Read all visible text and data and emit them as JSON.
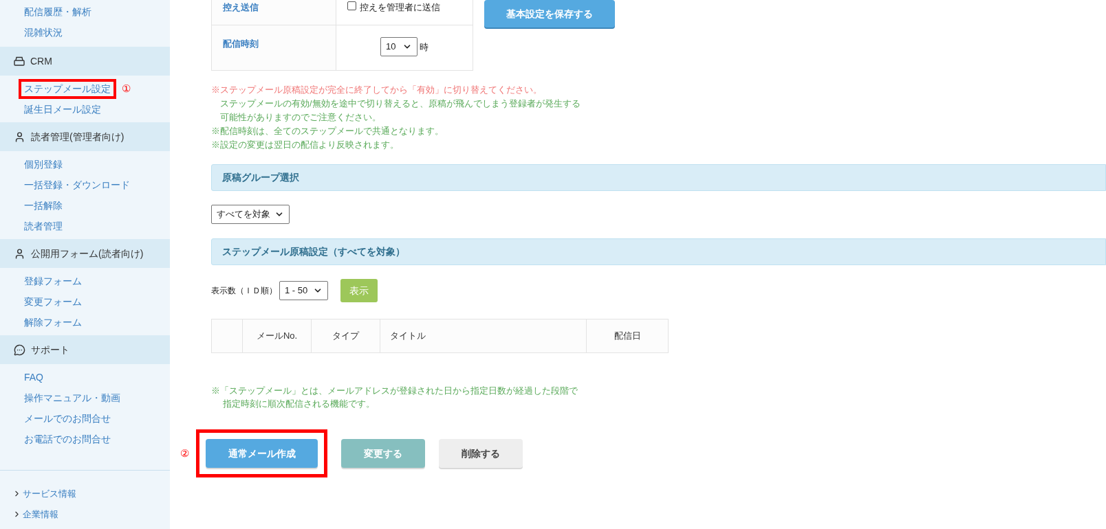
{
  "sidebar": {
    "top_items": [
      {
        "label": "配信履歴・解析"
      },
      {
        "label": "混雑状況"
      }
    ],
    "sections": [
      {
        "kind": "tray",
        "label": "CRM",
        "items": [
          {
            "label": "ステップメール設定",
            "annotation": "①"
          },
          {
            "label": "誕生日メール設定"
          }
        ]
      },
      {
        "kind": "person",
        "label": "読者管理(管理者向け)",
        "items": [
          {
            "label": "個別登録"
          },
          {
            "label": "一括登録・ダウンロード"
          },
          {
            "label": "一括解除"
          },
          {
            "label": "読者管理"
          }
        ]
      },
      {
        "kind": "person",
        "label": "公開用フォーム(読者向け)",
        "items": [
          {
            "label": "登録フォーム"
          },
          {
            "label": "変更フォーム"
          },
          {
            "label": "解除フォーム"
          }
        ]
      },
      {
        "kind": "chat",
        "label": "サポート",
        "items": [
          {
            "label": "FAQ"
          },
          {
            "label": "操作マニュアル・動画"
          },
          {
            "label": "メールでのお問合せ"
          },
          {
            "label": "お電話でのお問合せ"
          }
        ]
      }
    ],
    "footer_links": [
      "サービス情報",
      "企業情報"
    ]
  },
  "settings": {
    "cc_row": {
      "label": "控え送信",
      "checkbox_label": "控えを管理者に送信",
      "checked": false
    },
    "time_row": {
      "label": "配信時刻",
      "value": "10",
      "unit": "時"
    },
    "save_button": "基本設定を保存する"
  },
  "notes": [
    {
      "kind": "warning",
      "lines": [
        "※ステップメール原稿設定が完全に終了してから「有効」に切り替えてください。"
      ]
    },
    {
      "kind": "continuation",
      "lines": [
        "ステップメールの有効/無効を途中で切り替えると、原稿が飛んでしまう登録者が発生する",
        "可能性がありますのでご注意ください。"
      ]
    },
    {
      "kind": "info",
      "lines": [
        "※配信時刻は、全てのステップメールで共通となります。"
      ]
    },
    {
      "kind": "info",
      "lines": [
        "※設定の変更は翌日の配信より反映されます。"
      ]
    }
  ],
  "group_section": {
    "title": "原稿グループ選択",
    "select_value": "すべてを対象"
  },
  "draft_section": {
    "title": "ステップメール原稿設定（すべてを対象）",
    "count_label": "表示数（ＩＤ順）",
    "count_value": "1 - 50",
    "show_button": "表示",
    "table": {
      "columns": [
        "メールNo.",
        "タイプ",
        "タイトル",
        "配信日"
      ]
    }
  },
  "footnote": [
    "※「ステップメール」とは、メールアドレスが登録された日から指定日数が経過した段階で",
    "指定時刻に順次配信される機能です。"
  ],
  "actions": [
    {
      "label": "通常メール作成",
      "kind": "primary",
      "annotation": "②"
    },
    {
      "label": "変更する",
      "kind": "teal"
    },
    {
      "label": "削除する",
      "kind": "gray"
    }
  ]
}
